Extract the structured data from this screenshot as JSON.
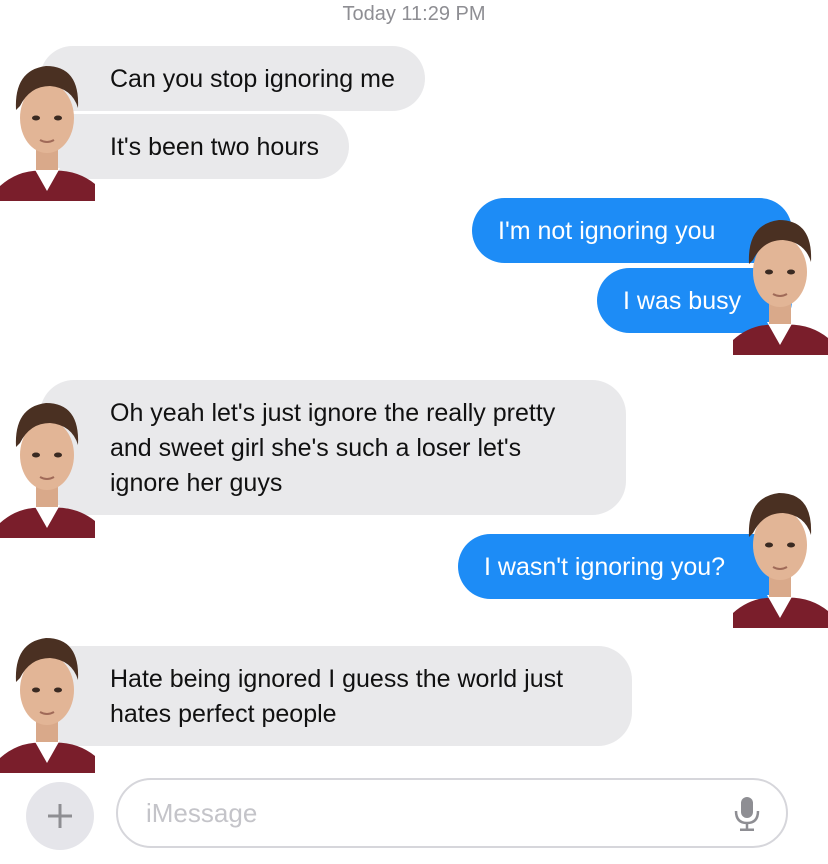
{
  "timestamp": {
    "day": "Today",
    "time": "11:29 PM"
  },
  "messages": [
    {
      "side": "in",
      "lines": [
        "Can you stop ignoring me"
      ]
    },
    {
      "side": "in",
      "lines": [
        "It's been two hours"
      ]
    },
    {
      "side": "out",
      "lines": [
        "I'm not ignoring you"
      ]
    },
    {
      "side": "out",
      "lines": [
        "I was busy"
      ]
    },
    {
      "side": "in",
      "lines": [
        "Oh yeah let's just ignore the really pretty",
        "and sweet girl she's such a loser let's",
        "ignore her guys"
      ]
    },
    {
      "side": "out",
      "lines": [
        "I wasn't ignoring you?"
      ]
    },
    {
      "side": "in",
      "lines": [
        "Hate being ignored I guess the world just",
        "hates perfect people"
      ]
    }
  ],
  "composer": {
    "placeholder": "iMessage",
    "add_icon": "plus-icon",
    "mic_icon": "microphone-icon"
  },
  "colors": {
    "incoming_bubble": "#e9e9eb",
    "outgoing_bubble": "#1d8cf6",
    "timestamp": "#8e8e93"
  }
}
